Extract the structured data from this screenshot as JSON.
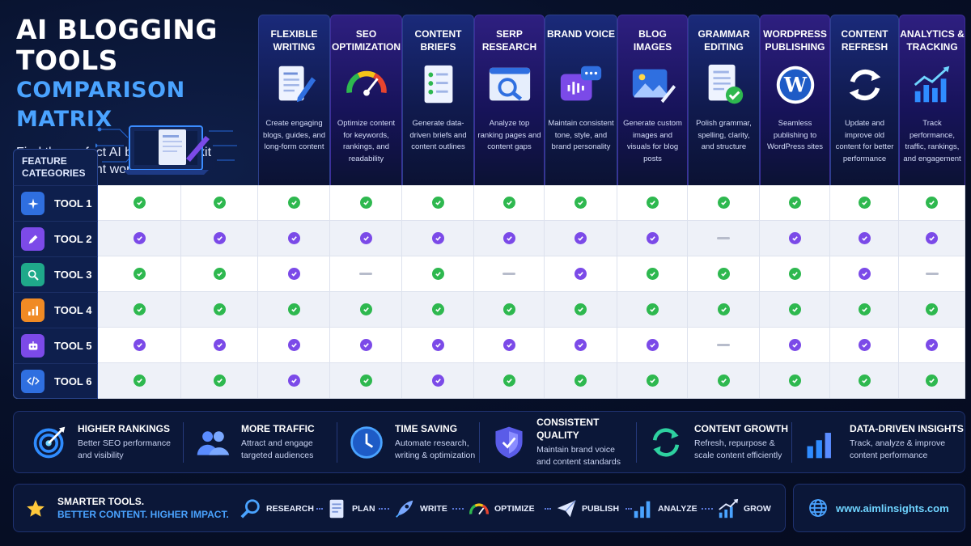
{
  "header": {
    "title_line1": "AI BLOGGING TOOLS",
    "title_line2": "COMPARISON MATRIX",
    "subtitle": "Find the perfect AI blogging toolkit for your content workflow"
  },
  "feature_categories_label": "FEATURE CATEGORIES",
  "columns": [
    {
      "title": "FLEXIBLE WRITING",
      "desc": "Create engaging blogs, guides, and long-form content",
      "icon": "document-pen-icon"
    },
    {
      "title": "SEO OPTIMIZATION",
      "desc": "Optimize content for keywords, rankings, and readability",
      "icon": "gauge-icon"
    },
    {
      "title": "CONTENT BRIEFS",
      "desc": "Generate data-driven briefs and content outlines",
      "icon": "checklist-icon"
    },
    {
      "title": "SERP RESEARCH",
      "desc": "Analyze top ranking pages and content gaps",
      "icon": "browser-search-icon"
    },
    {
      "title": "BRAND VOICE",
      "desc": "Maintain consistent tone, style, and brand personality",
      "icon": "voice-chat-icon"
    },
    {
      "title": "BLOG IMAGES",
      "desc": "Generate custom images and visuals for blog posts",
      "icon": "image-brush-icon"
    },
    {
      "title": "GRAMMAR EDITING",
      "desc": "Polish grammar, spelling, clarity, and structure",
      "icon": "document-check-icon"
    },
    {
      "title": "WORDPRESS PUBLISHING",
      "desc": "Seamless publishing to WordPress sites",
      "icon": "wordpress-icon"
    },
    {
      "title": "CONTENT REFRESH",
      "desc": "Update and improve old content for better performance",
      "icon": "refresh-icon"
    },
    {
      "title": "ANALYTICS & TRACKING",
      "desc": "Track performance, traffic, rankings, and engagement",
      "icon": "analytics-chart-icon"
    }
  ],
  "tools": [
    {
      "name": "TOOL 1",
      "icon": "sparkle-icon",
      "color": "#2f6fe0",
      "marks": [
        "g",
        "g",
        "g",
        "g",
        "g",
        "g",
        "g",
        "g",
        "g",
        "g",
        "g",
        "g"
      ]
    },
    {
      "name": "TOOL 2",
      "icon": "pen-icon",
      "color": "#7c4ae8",
      "marks": [
        "p",
        "p",
        "p",
        "p",
        "p",
        "p",
        "p",
        "p",
        "-",
        "p",
        "p",
        "p"
      ]
    },
    {
      "name": "TOOL 3",
      "icon": "magnifier-icon",
      "color": "#1fa98a",
      "marks": [
        "g",
        "g",
        "p",
        "-",
        "g",
        "-",
        "p",
        "g",
        "g",
        "g",
        "p",
        "-"
      ]
    },
    {
      "name": "TOOL 4",
      "icon": "bar-chart-icon",
      "color": "#f08a24",
      "marks": [
        "g",
        "g",
        "g",
        "g",
        "g",
        "g",
        "g",
        "g",
        "g",
        "g",
        "g",
        "g"
      ]
    },
    {
      "name": "TOOL 5",
      "icon": "robot-icon",
      "color": "#7c4ae8",
      "marks": [
        "p",
        "p",
        "p",
        "p",
        "p",
        "p",
        "p",
        "p",
        "-",
        "p",
        "p",
        "p"
      ]
    },
    {
      "name": "TOOL 6",
      "icon": "code-icon",
      "color": "#2f6fe0",
      "marks": [
        "g",
        "g",
        "p",
        "g",
        "p",
        "g",
        "g",
        "g",
        "g",
        "g",
        "g",
        "g"
      ]
    }
  ],
  "benefits": [
    {
      "title": "HIGHER RANKINGS",
      "desc1": "Better SEO performance",
      "desc2": "and visibility",
      "icon": "target-icon"
    },
    {
      "title": "MORE TRAFFIC",
      "desc1": "Attract and engage",
      "desc2": "targeted audiences",
      "icon": "users-icon"
    },
    {
      "title": "TIME SAVING",
      "desc1": "Automate research,",
      "desc2": "writing & optimization",
      "icon": "clock-icon"
    },
    {
      "title": "CONSISTENT QUALITY",
      "desc1": "Maintain brand voice",
      "desc2": "and content standards",
      "icon": "shield-icon"
    },
    {
      "title": "CONTENT GROWTH",
      "desc1": "Refresh, repurpose &",
      "desc2": "scale content efficiently",
      "icon": "cycle-icon"
    },
    {
      "title": "DATA-DRIVEN INSIGHTS",
      "desc1": "Track, analyze & improve",
      "desc2": "content performance",
      "icon": "bars-icon"
    }
  ],
  "footer": {
    "slogan1": "SMARTER TOOLS.",
    "slogan2": "BETTER CONTENT. HIGHER IMPACT.",
    "steps": [
      {
        "label": "RESEARCH",
        "icon": "search-icon"
      },
      {
        "label": "PLAN",
        "icon": "doc-icon"
      },
      {
        "label": "WRITE",
        "icon": "rocket-icon"
      },
      {
        "label": "OPTIMIZE",
        "icon": "speedometer-icon"
      },
      {
        "label": "PUBLISH",
        "icon": "paper-plane-icon"
      },
      {
        "label": "ANALYZE",
        "icon": "chart-icon"
      },
      {
        "label": "GROW",
        "icon": "growth-icon"
      }
    ],
    "website": "www.aimlinsights.com"
  },
  "colors": {
    "green": "#2eb84f",
    "purple": "#7b4ae8",
    "accent": "#4aa3ff"
  }
}
